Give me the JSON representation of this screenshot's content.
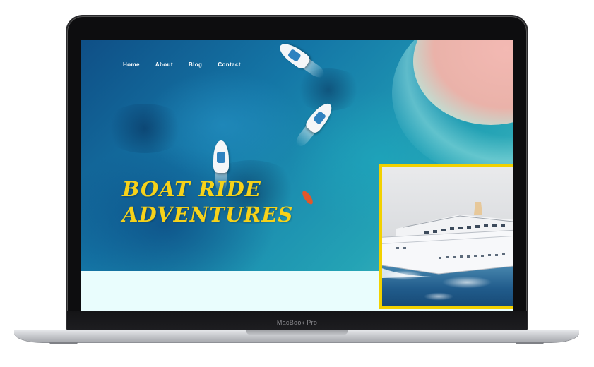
{
  "device": {
    "brand_label": "MacBook Pro"
  },
  "nav": {
    "items": [
      {
        "label": "Home"
      },
      {
        "label": "About"
      },
      {
        "label": "Blog"
      },
      {
        "label": "Contact"
      }
    ]
  },
  "hero": {
    "title_line1": "BOAT RIDE",
    "title_line2": "ADVENTURES"
  },
  "colors": {
    "accent_yellow": "#f2d100",
    "ocean_blue": "#1476a6",
    "band_background": "#e9fdfd"
  },
  "icons": [
    "boat-icon",
    "kayak-icon",
    "cruise-ship-image"
  ]
}
